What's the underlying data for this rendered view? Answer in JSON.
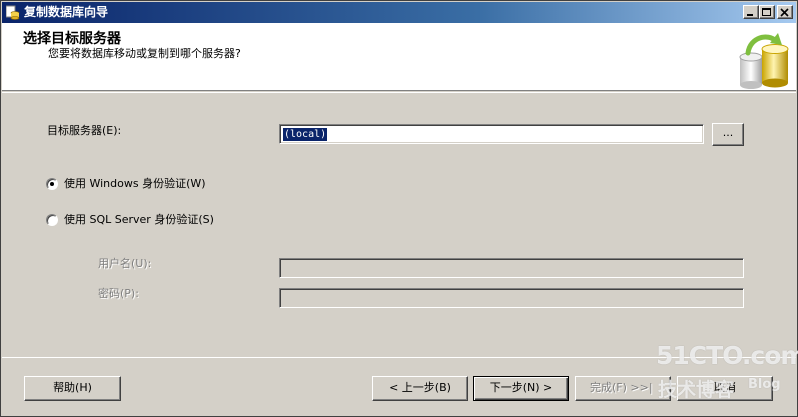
{
  "window": {
    "title": "复制数据库向导"
  },
  "header": {
    "title": "选择目标服务器",
    "subtitle": "您要将数据库移动或复制到哪个服务器?"
  },
  "form": {
    "server_label": "目标服务器(E):",
    "server_value": "(local)",
    "browse_label": "...",
    "auth_windows_label": "使用 Windows 身份验证(W)",
    "auth_sql_label": "使用 SQL Server 身份验证(S)",
    "auth_selected": "windows",
    "username_label": "用户名(U):",
    "username_value": "",
    "password_label": "密码(P):",
    "password_value": ""
  },
  "buttons": {
    "help": "帮助(H)",
    "back": "< 上一步(B)",
    "next": "下一步(N) >",
    "finish": "完成(F) >>|",
    "cancel": "取消"
  },
  "watermark": {
    "site": "51CTO.com",
    "blog_cn": "技术博客",
    "blog_en": "Blog"
  }
}
